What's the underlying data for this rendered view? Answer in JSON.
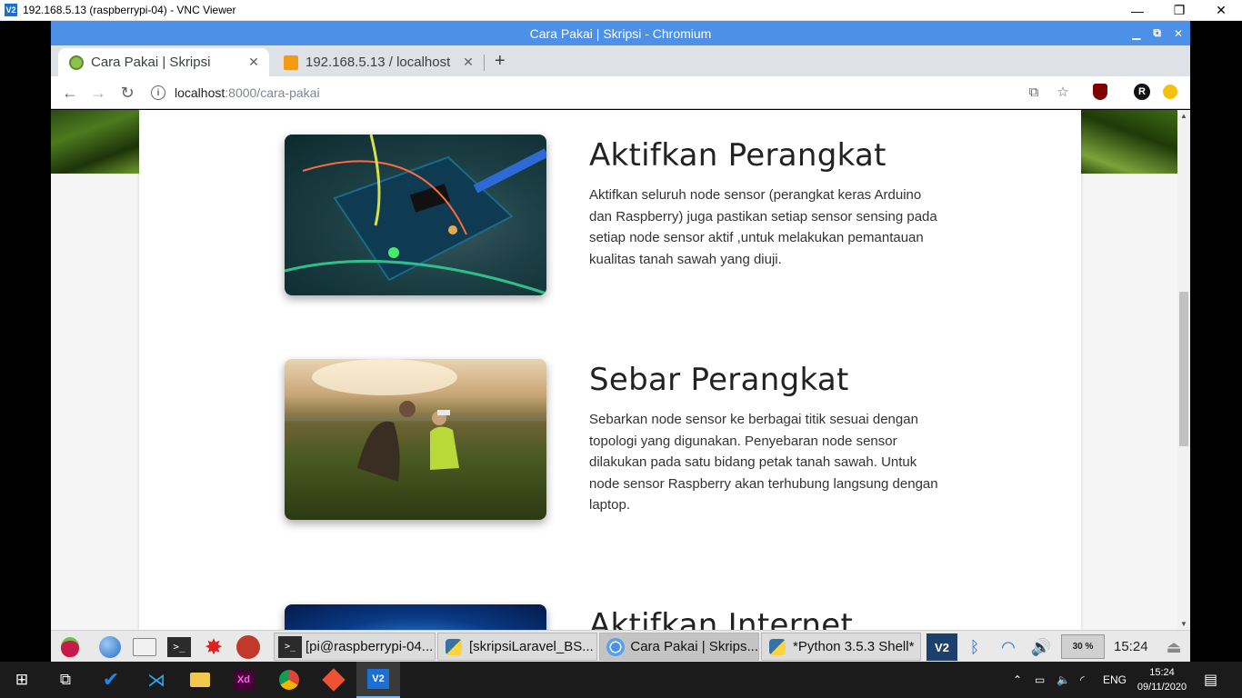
{
  "vnc": {
    "title": "192.168.5.13 (raspberrypi-04) - VNC Viewer",
    "logo": "V2",
    "minimize": "—",
    "maximize": "❐",
    "close": "✕"
  },
  "chromium": {
    "window_title": "Cara Pakai | Skripsi - Chromium",
    "tabs": [
      {
        "label": "Cara Pakai | Skripsi",
        "close": "✕",
        "favicon_color": "#8bc34a"
      },
      {
        "label": "192.168.5.13 / localhost",
        "close": "✕",
        "favicon_color": "#f39c12"
      }
    ],
    "new_tab": "+",
    "url_host": "localhost",
    "url_rest": ":8000/cara-pakai",
    "info_icon": "i"
  },
  "page": {
    "features": [
      {
        "title": "Aktifkan Perangkat",
        "text": "Aktifkan seluruh node sensor (perangkat keras Arduino dan Raspberry) juga pastikan setiap sensor sensing pada setiap node sensor aktif ,untuk melakukan pemantauan kualitas tanah sawah yang diuji."
      },
      {
        "title": "Sebar Perangkat",
        "text": "Sebarkan node sensor ke berbagai titik sesuai dengan topologi yang digunakan. Penyebaran node sensor dilakukan pada satu bidang petak tanah sawah. Untuk node sensor Raspberry akan terhubung langsung dengan laptop."
      },
      {
        "title": "Aktifkan Internet",
        "text": ""
      }
    ]
  },
  "rpi_panel": {
    "tasks": [
      {
        "label": "[pi@raspberrypi-04..."
      },
      {
        "label": "[skripsiLaravel_BS..."
      },
      {
        "label": "Cara Pakai | Skrips..."
      },
      {
        "label": "*Python 3.5.3 Shell*"
      }
    ],
    "cpu": "30 %",
    "clock": "15:24"
  },
  "windows": {
    "lang": "ENG",
    "time": "15:24",
    "date": "09/11/2020"
  },
  "colors": {
    "chromium_blue": "#4d90e8",
    "accent": "#76b9ed"
  }
}
